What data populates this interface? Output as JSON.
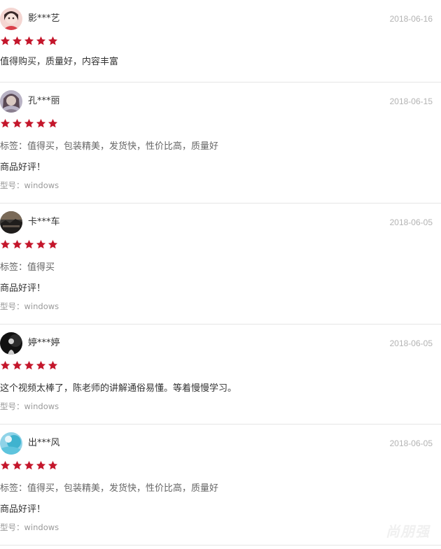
{
  "reviews": [
    {
      "user": "影***艺",
      "date": "2018-06-16",
      "rating": 5,
      "tags": "",
      "content": "值得购买，质量好，内容丰富",
      "model": "",
      "avatar_icon": "user-avatar-icon",
      "avatar_colors": [
        "#f4d6d2",
        "#3a2a2a",
        "#e8a0a0"
      ]
    },
    {
      "user": "孔***丽",
      "date": "2018-06-15",
      "rating": 5,
      "tags": "标签：值得买，包装精美，发货快，性价比高，质量好",
      "content": "商品好评！",
      "model": "型号：windows",
      "avatar_icon": "user-avatar-icon",
      "avatar_colors": [
        "#b8b2c4",
        "#5b4a55",
        "#d9c9c1"
      ]
    },
    {
      "user": "卡***车",
      "date": "2018-06-05",
      "rating": 5,
      "tags": "标签：值得买",
      "content": "商品好评！",
      "model": "型号：windows",
      "avatar_icon": "user-avatar-icon",
      "avatar_colors": [
        "#3d3a37",
        "#7a6a58",
        "#1f1d1c"
      ]
    },
    {
      "user": "婷***婷",
      "date": "2018-06-05",
      "rating": 5,
      "tags": "",
      "content": "这个视频太棒了，陈老师的讲解通俗易懂。等着慢慢学习。",
      "model": "型号：windows",
      "avatar_icon": "user-avatar-icon",
      "avatar_colors": [
        "#111111",
        "#2c2c2c",
        "#cfcfcf"
      ]
    },
    {
      "user": "出***风",
      "date": "2018-06-05",
      "rating": 5,
      "tags": "标签：值得买，包装精美，发货快，性价比高，质量好",
      "content": "商品好评！",
      "model": "型号：windows",
      "avatar_icon": "user-avatar-icon",
      "avatar_colors": [
        "#8fd3e8",
        "#3fb3cf",
        "#e9f6fa"
      ]
    }
  ],
  "watermark": "尚朋强",
  "colors": {
    "star": "#c4162b",
    "divider": "#e5e5e5",
    "date": "#b3b3b3"
  }
}
